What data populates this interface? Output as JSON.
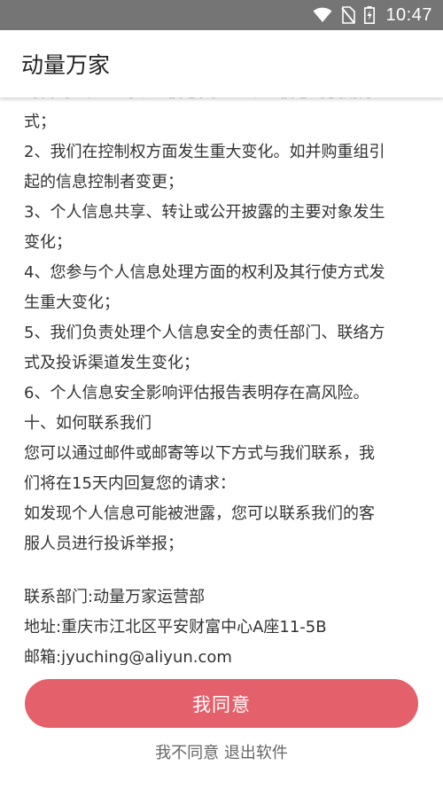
{
  "status_bar": {
    "time": "10:47",
    "icons": [
      "wifi-icon",
      "no-sim-icon",
      "battery-charging-icon"
    ]
  },
  "app_bar": {
    "title": "动量万家"
  },
  "policy": {
    "lines": [
      "的目的、处理的个人信息类型、个人信息的使用方",
      "式；",
      "2、我们在控制权方面发生重大变化。如并购重组引",
      "起的信息控制者变更；",
      "3、个人信息共享、转让或公开披露的主要对象发生",
      "变化；",
      "4、您参与个人信息处理方面的权利及其行使方式发",
      "生重大变化；",
      "5、我们负责处理个人信息安全的责任部门、联络方",
      "式及投诉渠道发生变化；",
      "6、个人信息安全影响评估报告表明存在高风险。",
      "十、如何联系我们",
      "您可以通过邮件或邮寄等以下方式与我们联系，我",
      "们将在15天内回复您的请求：",
      "如发现个人信息可能被泄露，您可以联系我们的客",
      "服人员进行投诉举报；"
    ],
    "contact_department": "联系部门:动量万家运营部",
    "contact_address": "地址:重庆市江北区平安财富中心A座11-5B",
    "contact_email": "邮箱:jyuching@aliyun.com"
  },
  "actions": {
    "agree_label": "我同意",
    "disagree_label": "我不同意 退出软件"
  },
  "colors": {
    "status_bar": "#757575",
    "agree_button": "#e4606a",
    "body_text": "#333333"
  }
}
